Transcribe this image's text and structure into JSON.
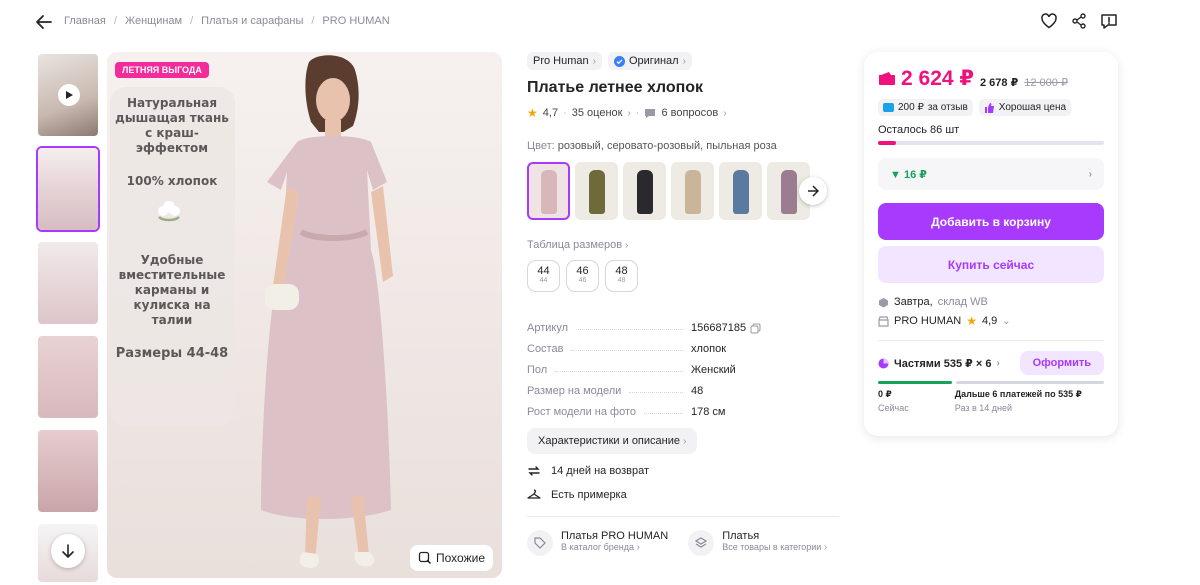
{
  "breadcrumbs": [
    "Главная",
    "Женщинам",
    "Платья и сарафаны",
    "PRO HUMAN"
  ],
  "main_image": {
    "badge": "ЛЕТНЯЯ ВЫГОДА",
    "promo_1": "Натуральная дышащая ткань с краш-эффектом",
    "promo_2": "100% хлопок",
    "promo_3": "Удобные вместительные карманы и кулиска на талии",
    "promo_4": "Размеры 44-48",
    "similar_label": "Похожие"
  },
  "product": {
    "brand": "Pro Human",
    "original_label": "Оригинал",
    "title": "Платье летнее хлопок",
    "rating": "4,7",
    "reviews": "35 оценок",
    "questions": "6 вопросов",
    "color_label": "Цвет:",
    "color_value": "розовый, серовато-розовый, пыльная роза",
    "size_table_label": "Таблица размеров",
    "sizes": [
      {
        "n": "44",
        "s": "44"
      },
      {
        "n": "46",
        "s": "46"
      },
      {
        "n": "48",
        "s": "48"
      }
    ],
    "specs": [
      {
        "k": "Артикул",
        "v": "156687185"
      },
      {
        "k": "Состав",
        "v": "хлопок"
      },
      {
        "k": "Пол",
        "v": "Женский"
      },
      {
        "k": "Размер на модели",
        "v": "48"
      },
      {
        "k": "Рост модели на фото",
        "v": "178 см"
      }
    ],
    "chars_button": "Характеристики и описание",
    "return_text": "14 дней на возврат",
    "fitting_text": "Есть примерка",
    "brand_link_title": "Платья PRO HUMAN",
    "brand_link_sub": "В каталог бренда",
    "cat_link_title": "Платья",
    "cat_link_sub": "Все товары в категории"
  },
  "price_card": {
    "price": "2 624 ₽",
    "price_wallet": "2 678 ₽",
    "price_old": "12 000 ₽",
    "review_bonus": "200 ₽",
    "review_bonus_label": "за отзыв",
    "good_price": "Хорошая цена",
    "stock": "Осталось 86 шт",
    "stock_fraction": 0.08,
    "discount": "16 ₽",
    "add_to_cart": "Добавить в корзину",
    "buy_now": "Купить сейчас",
    "delivery": "Завтра,",
    "warehouse": "склад WB",
    "seller": "PRO HUMAN",
    "seller_rating": "4,9",
    "parts_label": "Частями 535 ₽ × 6",
    "parts_button": "Оформить",
    "parts_now_value": "0 ₽",
    "parts_now_label": "Сейчас",
    "parts_later_value": "Дальше 6 платежей по 535 ₽",
    "parts_later_label": "Раз в 14 дней"
  },
  "colors": {
    "accent": "#a73afd",
    "price": "#f1117e",
    "badge": "#f32b9b",
    "rating_star": "#f7a501"
  }
}
